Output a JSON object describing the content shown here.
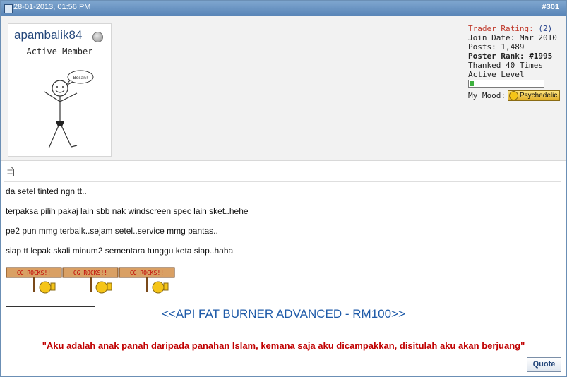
{
  "post": {
    "date": "28-01-2013, 01:56 PM",
    "number": "#301"
  },
  "user": {
    "name": "apambalik84",
    "title": "Active Member",
    "avatar_speech": "Bosan!"
  },
  "stats": {
    "trader_rating_label": "Trader Rating:",
    "trader_rating_value": "(2)",
    "join_date": "Join Date: Mar 2010",
    "posts": "Posts: 1,489",
    "poster_rank": "Poster Rank: #1995",
    "thanked": "Thanked 40 Times",
    "active_level_label": "Active Level",
    "active_level_fraction": 0.06,
    "mood_label": "My Mood:",
    "mood_value": "Psychedelic"
  },
  "body": {
    "lines": [
      "da setel tinted ngn tt..",
      "terpaksa pilih pakaj lain sbb nak windscreen spec lain sket..hehe",
      "pe2 pun mmg terbaik..sejam setel..service mmg pantas..",
      "siap tt lepak skali minum2 sementara tunggu keta siap..haha"
    ],
    "cg_sign_text": "CG ROCKS!!"
  },
  "signature": {
    "link": "<<API FAT BURNER ADVANCED - RM100>>",
    "quote": "\"Aku adalah anak panah daripada panahan Islam, kemana saja aku dicampakkan, disitulah aku akan berjuang\""
  },
  "actions": {
    "quote_button": "Quote"
  },
  "colors": {
    "header_bg": "#6b93c2",
    "username": "#23467a",
    "trader_label": "#c0392b",
    "link": "#1e5aa8",
    "quote": "#c00000",
    "level_fill": "#3fb13f"
  }
}
